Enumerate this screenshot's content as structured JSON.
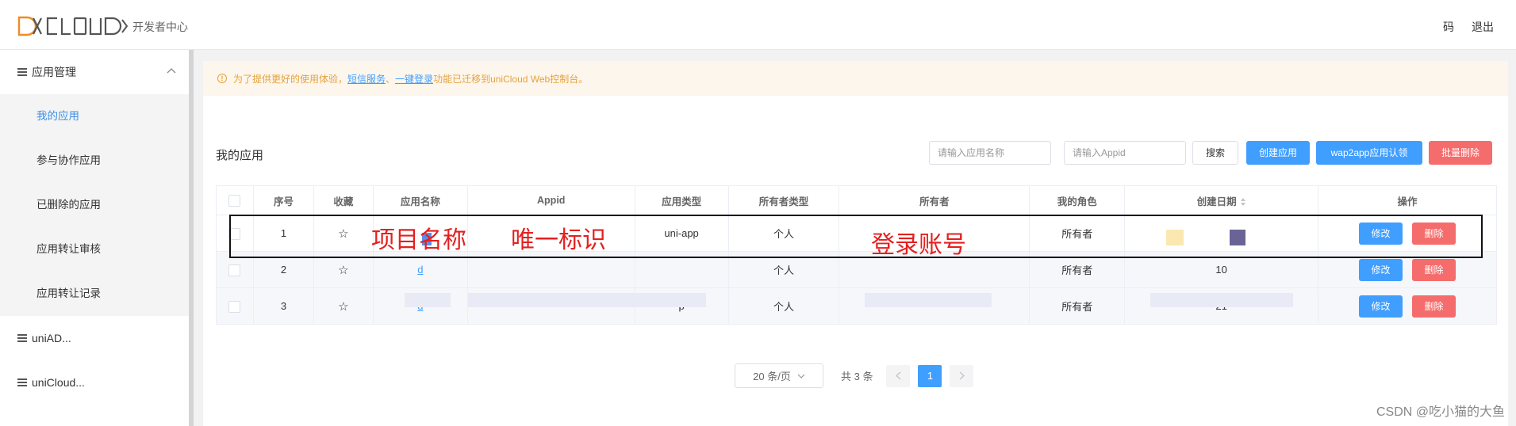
{
  "header": {
    "subtitle": "开发者中心",
    "right_links": [
      "码",
      "退出"
    ]
  },
  "sidebar": {
    "groups": [
      {
        "label": "应用管理",
        "expanded": true,
        "items": [
          "我的应用",
          "参与协作应用",
          "已删除的应用",
          "应用转让审核",
          "应用转让记录"
        ],
        "active": "我的应用"
      },
      {
        "label": "uniAD..."
      },
      {
        "label": "uniCloud..."
      }
    ]
  },
  "notice": {
    "prefix": "为了提供更好的使用体验，",
    "link1": "短信服务",
    "sep": "、",
    "link2": "一键登录",
    "suffix": "功能已迁移到uniCloud Web控制台。"
  },
  "section_title": "我的应用",
  "toolbar": {
    "name_placeholder": "请输入应用名称",
    "appid_placeholder": "请输入Appid",
    "search": "搜索",
    "create": "创建应用",
    "claim": "wap2app应用认领",
    "batch_delete": "批量删除"
  },
  "table": {
    "headers": [
      "序号",
      "收藏",
      "应用名称",
      "Appid",
      "应用类型",
      "所有者类型",
      "所有者",
      "我的角色",
      "创建日期",
      "操作"
    ],
    "rows": [
      {
        "no": "1",
        "name": "",
        "appid": "",
        "type": "uni-app",
        "owner_type": "个人",
        "owner": "",
        "role": "所有者",
        "date": ""
      },
      {
        "no": "2",
        "name": "d",
        "appid": "",
        "type": "",
        "owner_type": "个人",
        "owner": "",
        "role": "所有者",
        "date": "10"
      },
      {
        "no": "3",
        "name": "d",
        "appid": "",
        "type": "p",
        "owner_type": "个人",
        "owner": "",
        "role": "所有者",
        "date": "21"
      }
    ],
    "edit": "修改",
    "delete": "删除"
  },
  "annotations": {
    "name": "项目名称",
    "appid": "唯一标识",
    "owner": "登录账号"
  },
  "pagination": {
    "page_size": "20 条/页",
    "total": "共 3 条",
    "current": "1"
  },
  "watermark": "CSDN @吃小猫的大鱼",
  "colors": {
    "primary": "#409eff",
    "danger": "#f56c6c",
    "warning": "#e6a23c"
  }
}
